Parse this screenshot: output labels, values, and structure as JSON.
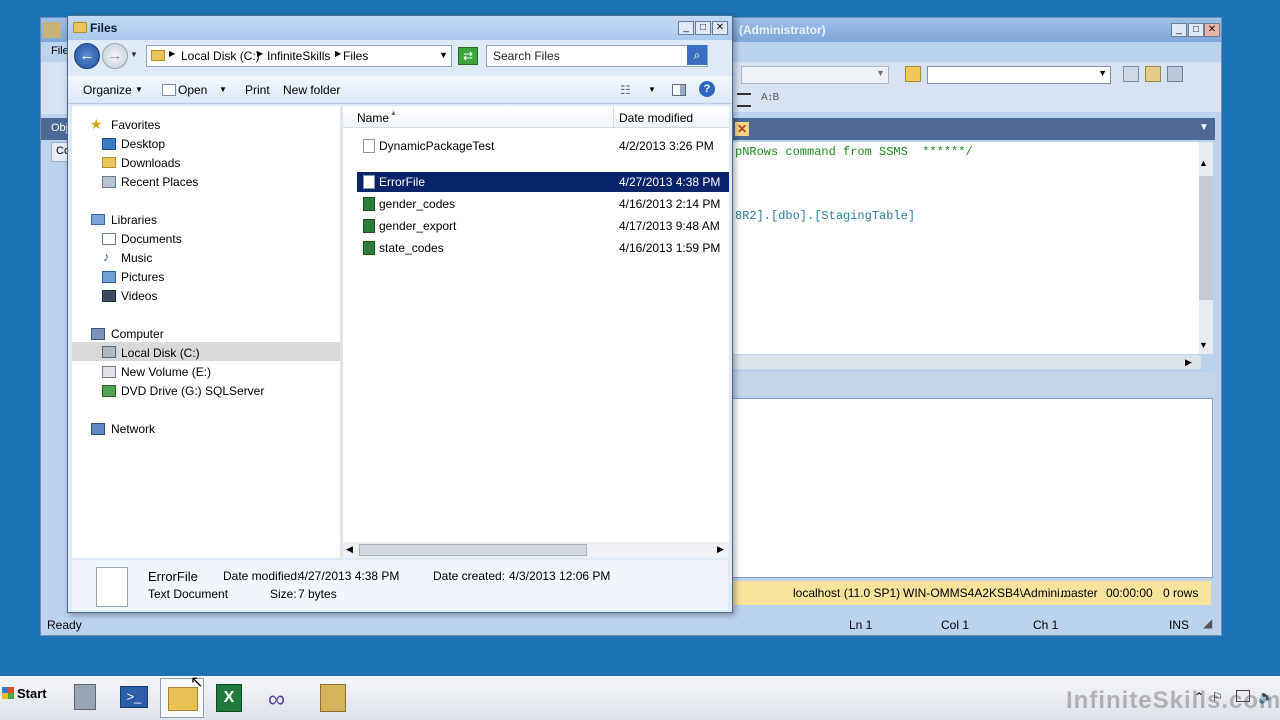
{
  "ssms": {
    "title_fragment": "(Administrator)",
    "menu_fragment": "File",
    "pane_fragment_1": "Obj",
    "pane_fragment_2": "Co",
    "editor": {
      "line1": "pNRows command from SSMS  ******/",
      "line2": "8R2].[dbo].[StagingTable]"
    },
    "query_status": {
      "server": "localhost (11.0 SP1)",
      "user": "WIN-OMMS4A2KSB4\\Admini...",
      "database": "master",
      "elapsed": "00:00:00",
      "rows": "0 rows"
    },
    "status_bar": {
      "ready": "Ready",
      "ln": "Ln 1",
      "col": "Col 1",
      "ch": "Ch 1",
      "mode": "INS"
    }
  },
  "explorer": {
    "title": "Files",
    "address": {
      "crumbs": [
        "Local Disk (C:)",
        "InfiniteSkills",
        "Files"
      ]
    },
    "search": {
      "placeholder": "Search Files"
    },
    "command_bar": {
      "organize": "Organize",
      "open": "Open",
      "print": "Print",
      "new_folder": "New folder"
    },
    "nav": {
      "favorites": "Favorites",
      "desktop": "Desktop",
      "downloads": "Downloads",
      "recent_places": "Recent Places",
      "libraries": "Libraries",
      "documents": "Documents",
      "music": "Music",
      "pictures": "Pictures",
      "videos": "Videos",
      "computer": "Computer",
      "local_disk": "Local Disk (C:)",
      "new_volume": "New Volume (E:)",
      "dvd_drive": "DVD Drive (G:) SQLServer",
      "network": "Network"
    },
    "columns": {
      "name": "Name",
      "date_modified": "Date modified"
    },
    "files": [
      {
        "name": "DynamicPackageTest",
        "date": "4/2/2013 3:26 PM"
      },
      {
        "name": "ErrorFile",
        "date": "4/27/2013 4:38 PM"
      },
      {
        "name": "gender_codes",
        "date": "4/16/2013 2:14 PM"
      },
      {
        "name": "gender_export",
        "date": "4/17/2013 9:48 AM"
      },
      {
        "name": "state_codes",
        "date": "4/16/2013 1:59 PM"
      }
    ],
    "details": {
      "name": "ErrorFile",
      "type": "Text Document",
      "date_modified_label": "Date modified:",
      "date_modified": "4/27/2013 4:38 PM",
      "size_label": "Size:",
      "size": "7 bytes",
      "date_created_label": "Date created:",
      "date_created": "4/3/2013 12:06 PM"
    }
  },
  "taskbar": {
    "start": "Start",
    "watermark": "InfiniteSkills.com"
  },
  "colors": {
    "desktop": "#1b73b3",
    "selection": "#0a246a",
    "query_status": "#f7e39c"
  }
}
